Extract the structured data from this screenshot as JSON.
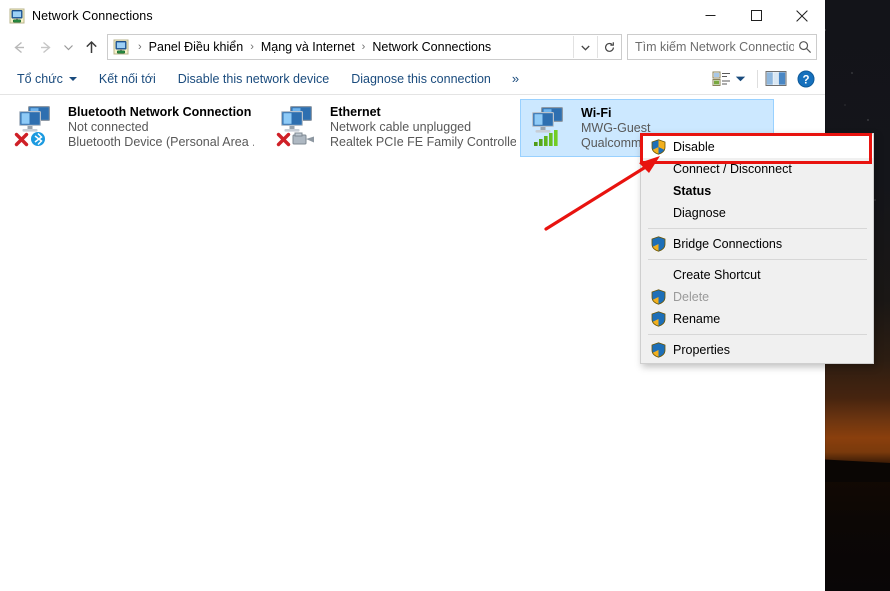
{
  "window": {
    "title": "Network Connections",
    "app_icon": "network-connections-icon",
    "buttons": {
      "minimize": "minimize-icon",
      "maximize": "maximize-icon",
      "close": "close-icon"
    }
  },
  "navbar": {
    "back": "back-arrow-icon",
    "forward": "forward-arrow-icon",
    "recent": "recent-locations-chevron-icon",
    "up": "up-arrow-icon",
    "breadcrumb": {
      "icon": "control-panel-icon",
      "separator": "›",
      "items": [
        "Panel Điều khiển",
        "Mạng và Internet",
        "Network Connections"
      ],
      "dropdown": "chevron-down-icon",
      "refresh": "refresh-icon"
    },
    "search": {
      "placeholder": "Tìm kiếm Network Connections",
      "icon": "search-icon"
    }
  },
  "command_bar": {
    "items": [
      {
        "label": "Tổ chức",
        "has_caret": true
      },
      {
        "label": "Kết nối tới",
        "has_caret": false
      },
      {
        "label": "Disable this network device",
        "has_caret": false
      },
      {
        "label": "Diagnose this connection",
        "has_caret": false
      }
    ],
    "overflow": "»",
    "right_icons": [
      "change-view-icon",
      "view-dropdown-chevron-icon",
      "preview-pane-icon",
      "help-icon"
    ]
  },
  "connections": [
    {
      "name": "Bluetooth Network Connection",
      "status": "Not connected",
      "device": "Bluetooth Device (Personal Area ...",
      "icon": "network-adapter-icon",
      "overlay": "bluetooth-icon",
      "disabled_mark": "red-x-icon",
      "selected": false
    },
    {
      "name": "Ethernet",
      "status": "Network cable unplugged",
      "device": "Realtek PCIe FE Family Controller",
      "icon": "network-adapter-icon",
      "overlay": "ethernet-cable-icon",
      "disabled_mark": "red-x-icon",
      "selected": false
    },
    {
      "name": "Wi-Fi",
      "status": "MWG-Guest",
      "device": "Qualcomm",
      "icon": "network-adapter-icon",
      "overlay": "wifi-signal-bars-icon",
      "disabled_mark": "",
      "selected": true
    }
  ],
  "context_menu": {
    "items": [
      {
        "label": "Disable",
        "shield": true,
        "bold": false,
        "disabled": false,
        "highlighted": true
      },
      {
        "label": "Connect / Disconnect",
        "shield": false,
        "bold": false,
        "disabled": false,
        "highlighted": false
      },
      {
        "label": "Status",
        "shield": false,
        "bold": true,
        "disabled": false,
        "highlighted": false
      },
      {
        "label": "Diagnose",
        "shield": false,
        "bold": false,
        "disabled": false,
        "highlighted": false
      },
      {
        "separator": true
      },
      {
        "label": "Bridge Connections",
        "shield": true,
        "bold": false,
        "disabled": false,
        "highlighted": false
      },
      {
        "separator": true
      },
      {
        "label": "Create Shortcut",
        "shield": false,
        "bold": false,
        "disabled": false,
        "highlighted": false
      },
      {
        "label": "Delete",
        "shield": true,
        "bold": false,
        "disabled": true,
        "highlighted": false
      },
      {
        "label": "Rename",
        "shield": true,
        "bold": false,
        "disabled": false,
        "highlighted": false
      },
      {
        "separator": true
      },
      {
        "label": "Properties",
        "shield": true,
        "bold": false,
        "disabled": false,
        "highlighted": false
      }
    ]
  },
  "annotations": {
    "highlight_color": "#e8130f",
    "arrow": "red-arrow-pointing-to-disable",
    "highlight_target": "Disable"
  },
  "colors": {
    "selection": "#cce8ff",
    "command_link": "#1a4b7d",
    "menu_background": "#f0f0f0",
    "annotation_red": "#e8130f"
  }
}
